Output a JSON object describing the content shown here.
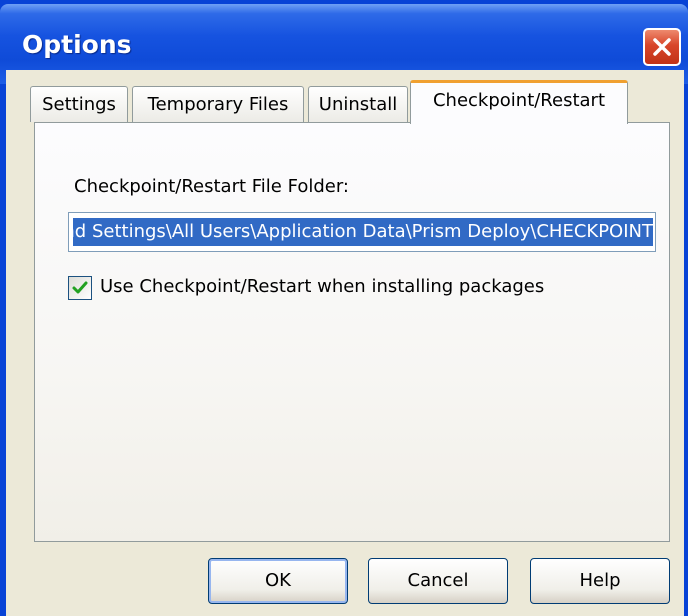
{
  "window": {
    "title": "Options",
    "close_glyph": "close-icon"
  },
  "tabs": [
    {
      "label": "Settings"
    },
    {
      "label": "Temporary Files"
    },
    {
      "label": "Uninstall"
    },
    {
      "label": "Checkpoint/Restart",
      "active": true
    }
  ],
  "panel": {
    "folder_label": "Checkpoint/Restart File Folder:",
    "folder_value": "C:\\Documents and Settings\\All Users\\Application Data\\Prism Deploy\\CHECKPOINT",
    "checkbox": {
      "label": "Use Checkpoint/Restart when installing packages",
      "checked": true
    }
  },
  "buttons": {
    "ok": "OK",
    "cancel": "Cancel",
    "help": "Help"
  },
  "colors": {
    "titlebar": "#0f4bd8",
    "selection": "#316ac5",
    "active_tab_accent": "#f0a030",
    "close": "#d8452a"
  }
}
